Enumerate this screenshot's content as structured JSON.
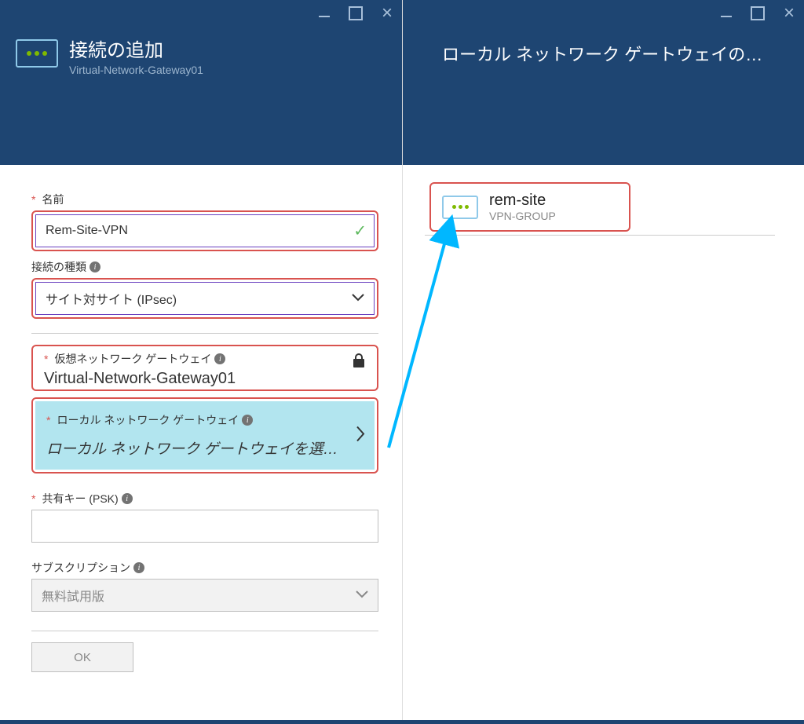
{
  "left": {
    "title": "接続の追加",
    "subtitle": "Virtual-Network-Gateway01",
    "fields": {
      "name_label": "名前",
      "name_value": "Rem-Site-VPN",
      "conn_type_label": "接続の種類",
      "conn_type_value": "サイト対サイト (IPsec)",
      "vng_label": "仮想ネットワーク ゲートウェイ",
      "vng_value": "Virtual-Network-Gateway01",
      "lng_label": "ローカル ネットワーク ゲートウェイ",
      "lng_value": "ローカル ネットワーク ゲートウェイを選…",
      "psk_label": "共有キー (PSK)",
      "sub_label": "サブスクリプション",
      "sub_value": "無料試用版",
      "ok": "OK"
    }
  },
  "right": {
    "title": "ローカル ネットワーク ゲートウェイの…",
    "item": {
      "name": "rem-site",
      "group": "VPN-GROUP"
    }
  }
}
